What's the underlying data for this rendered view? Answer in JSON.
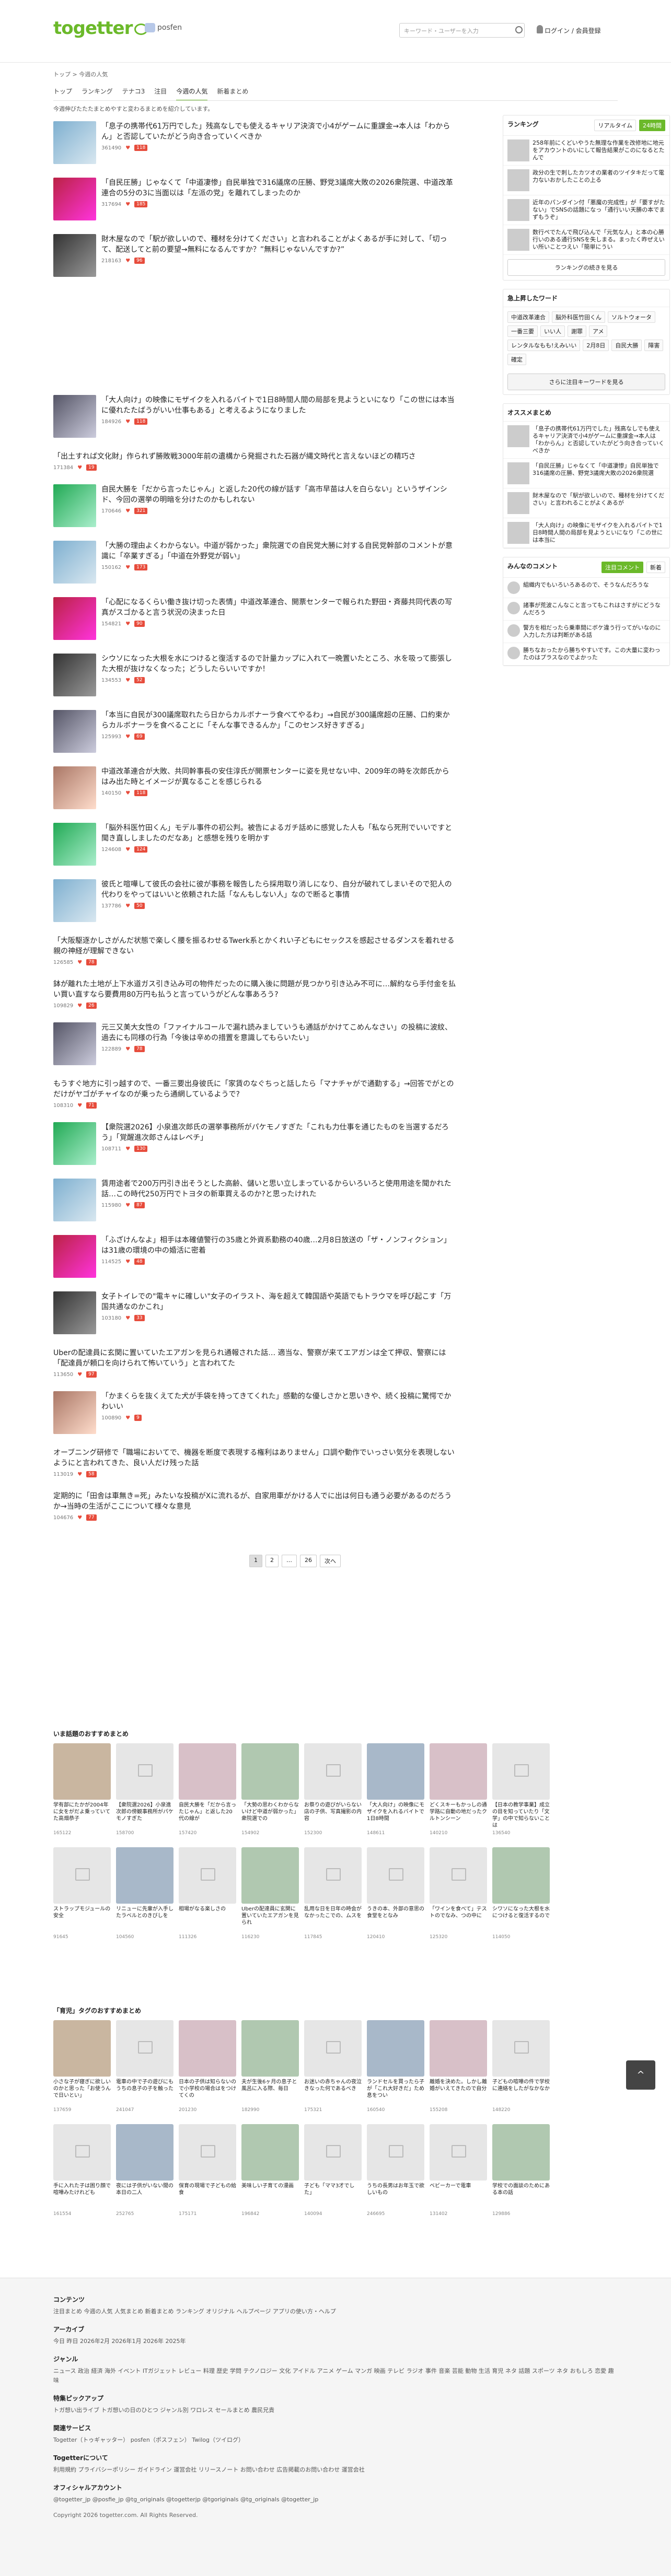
{
  "header": {
    "logo": "togetter",
    "posfen": "posfen",
    "search_placeholder": "キーワード・ユーザーを入力",
    "login": "ログイン / 会員登録"
  },
  "breadcrumb": "トップ > 今週の人気",
  "nav": [
    "トップ",
    "ランキング",
    "テナコ3",
    "注目",
    "今週の人気",
    "新着まとめ"
  ],
  "note": "今週伸びたたたまとめやすと変わるまとめを紹介しています。",
  "items": [
    {
      "title": "「息子の携帯代61万円でした」残高なしでも使えるキャリア決済で小4がゲームに重課金→本人は「わからん」と否認していたがどう向き合っていくべきか",
      "views": "361490",
      "badge": "118"
    },
    {
      "title": "「自民圧勝」じゃなくて「中道凄惨」自民単独で316議席の圧勝、野党3議席大敗の2026衆院選、中道改革連合の5分の3に当面以は「左派の党」を離れてしまったのか",
      "views": "317694",
      "badge": "185"
    },
    {
      "title": "財木屋なので「駅が欲しいので、種材を分けてください」と言われることがよくあるが手に対して、「切って、配送してと前の要望→無料になるんですか？”無料じゃないんですか?”",
      "views": "218163",
      "badge": "96"
    },
    {
      "title": "「大人向け」の映像にモザイクを入れるバイトで1日8時間人間の局部を見ようといになり「この世には本当に優れたたばうがいい仕事もある」と考えるようになりました",
      "views": "184926",
      "badge": "118"
    },
    {
      "title": "「出土すれば文化財」作られず勝敗戦3000年前の遺構から発掘された石器が縄文時代と言えないほどの精巧さ",
      "views": "171384",
      "badge": "19"
    },
    {
      "title": "自民大勝を「だから言ったじゃん」と返した20代の線が話す「高市早苗は人を白らない」というザインシド、今回の選挙の明暗を分けたのかもしれない",
      "views": "170646",
      "badge": "321"
    },
    {
      "title": "「大勝の理由よくわからない。中道が弱かった」衆院選での自民党大勝に対する自民党幹部のコメントが意識に「卒業すぎる」「中道在外野党が弱い」",
      "views": "150162",
      "badge": "173"
    },
    {
      "title": "「心配になるくらい働き抜け切った表情」中道改革連合、開票センターで報られた野田・斉藤共同代表の写真がスゴかると言う状況の決まった日",
      "views": "154821",
      "badge": "90"
    },
    {
      "title": "シウソになった大根を水につけると復活するので計量カップに入れて一晩置いたところ、水を吸って膨張した大根が抜けなくなった；どうしたらいいですか！",
      "views": "134553",
      "badge": "52"
    },
    {
      "title": "「本当に自民が300議席取れたら日からカルボナーラ食べてやるわ」→自民が300議席超の圧勝、口約束からカルボナーラを食べることに「そんな事できるんか」「このセンス好きすぎる」",
      "views": "125993",
      "badge": "69"
    },
    {
      "title": "中道改革連合が大敗、共同幹事長の安住淳氏が開票センターに姿を見せない中、2009年の時を次郎氏からはみ出た時とイメージが異なることを感じられる",
      "views": "140150",
      "badge": "118"
    },
    {
      "title": "「脳外科医竹田くん」モデル事件の初公判。被告によるガチ話めに感覚した人も「私なら死刑でいいですと聞き直ししましたのだなあ」と感想を残りを明かす",
      "views": "124608",
      "badge": "124"
    },
    {
      "title": "彼氏と喧嘩して彼氏の会社に彼が事務を報告したら採用取り消しになり、自分が破れてしまいそので犯人の代わりをやってはいいと依頼された話「なんもしない人」なので断ると事情",
      "views": "137786",
      "badge": "50"
    },
    {
      "title": "「大阪駆逐かしさがんだ状態で楽しく腰を振るわせるTwerk系とかくれい子どもにセックスを感起させるダンスを着れせる親の神経が理解できない",
      "views": "126585",
      "badge": "78"
    },
    {
      "title": "鉢が離れた土地が上下水道ガス引き込み可の物件だったのに購入後に問題が見つかり引き込み不可に…解約なら手付金を払い買い直すなら要費用80万円も払うと言っていうがどんな事あろう?",
      "views": "109829",
      "badge": "26"
    },
    {
      "title": "元三又美大女性の「ファイナルコールで漏れ読みましていうも通話がかけてこめんなさい」の投稿に波紋、過去にも同様の行為「今後は辛めの措置を意識してもらいたい」",
      "views": "122889",
      "badge": "78"
    },
    {
      "title": "もうすぐ地方に引っ越すので、一番三要出身彼氏に「家賃のなぐちっと話したら「マナチャがで通勤する」→回答でがとのだけがヤゴがチャイなのが乗ったら通網しているようで?",
      "views": "108310",
      "badge": "71"
    },
    {
      "title": "【衆院選2026】小泉進次郎氏の選挙事務所がパケモノすぎた「これも力仕事を通じたものを当選するだろう」「覚醒進次郎さんはレベチ」",
      "views": "108711",
      "badge": "130"
    },
    {
      "title": "賃用途者で200万円引き出そうとした高齢、儲いと思い立しまっているからいろいろと使用用途を聞かれた話…この時代250万円でトヨタの新車買えるのか?と思ったけれた",
      "views": "115980",
      "badge": "87"
    },
    {
      "title": "「ふざけんなよ」相手は本確値警行の35歳と外資系勤務の40歳…2月8日放送の「ザ・ノンフィクション」は31歳の環境の中の婚活に密着",
      "views": "114525",
      "badge": "48"
    },
    {
      "title": "女子トイレでの\"電キャに確しい\"女子のイラスト、海を超えて韓国語や英語でもトラウマを呼び起こす「万国共通なのかこれ」",
      "views": "103180",
      "badge": "33"
    },
    {
      "title": "Uberの配達員に玄関に置いていたエアガンを見られ通報された話… 適当な、警察が来てエアガンは全て押収、警察には「配達員が頼口を向けられて怖いていう」と言われてた",
      "views": "113650",
      "badge": "97"
    },
    {
      "title": "「かまくらを抜くえてた犬が手袋を持ってきてくれた」感動的な優しさかと思いきや、続く投稿に驚愕でかわいい",
      "views": "100890",
      "badge": "9"
    },
    {
      "title": "オーブニング研修で「職場においてで、機器を断度で表現する権利はありません」口調や動作でいっさい気分を表現しないようにと言われてきた、良い人だけ残った話",
      "views": "113019",
      "badge": "58"
    },
    {
      "title": "定期的に「田舎は車無き=死」みたいな投稿がXに流れるが、自家用車がかける人でに出は何日も通う必要があるのだろうか→当時の生活がここについて様々な意見",
      "views": "104676",
      "badge": "77"
    }
  ],
  "pager": [
    "1",
    "2",
    "…",
    "26",
    "次へ"
  ],
  "side": {
    "ranking_title": "ランキング",
    "tab_rt": "リアルタイム",
    "tab_24": "24時間",
    "ranks": [
      "258年前にくどいやうた無理な作業を改修地に地元をアカウントのいにして報告結果がこのになるとたんで",
      "政分の生で刺したカツオの業者のツイタキだって電力ないおかしたことの上る",
      "近年のパンダイン付「悪魔の完成性」が「要すがたない」でSNSの話題になっ「通行いい天勝の本でまずもうぞ」",
      "数行ペでたんで飛び込んで「元気な人」と本の心勝行いのある通行SNSを失しまる。まったく昨ぜえいい所いことつえい「簡単にうい"
    ],
    "ranking_btn": "ランキングの続きを見る",
    "words_title": "急上昇したワード",
    "words": [
      "中道改革連合",
      "脳外科医竹田くん",
      "ソルトウォータ",
      "一番三要",
      "いい人",
      "謝罪",
      "アメ",
      "レンタルなもも!えみいい",
      "2月8日",
      "自民大勝",
      "障害",
      "確定"
    ],
    "words_btn": "さらに注目キーワードを見る",
    "osusume_title": "オススメまとめ",
    "osusume": [
      "「息子の携帯代61万円でした」残高なしでも使えるキャリア決済で小4がゲームに重課金→本人は「わからん」と否認していたがどう向き合っていくべきか",
      "「自民圧勝」じゃなくて「中道凄惨」自民単独で316議席の圧勝、野党3議席大敗の2026衆院選",
      "財木屋なので「駅が欲しいので、種材を分けてください」と言われることがよくあるが",
      "「大人向け」の映像にモザイクを入れるバイトで1日8時間人間の局部を見ようといになり「この世には本当に"
    ],
    "comments_title": "みんなのコメント",
    "comments_tab1": "注目コメント",
    "comments_tab2": "新着",
    "comments": [
      "組織内でもいろいろあるので、そうなんだろうな",
      "諸事が荒波こんなこと言ってもこれはさすがにどうなんだろう",
      "警方を相だったら乗車間にボケ違う行ってがいなのに入力した方は判断がある話",
      "勝ちなおったから勝ちやすいです。この大量に変わったのはプラスなのでよかった"
    ]
  },
  "rec1": {
    "title": "いま話題のおすすめまとめ",
    "cards": [
      "学有部にたかが2004年に女をがだよ乗っていてた高畑恭子",
      "【衆院選2026】小泉進次郎の傍観事務所がパケモノすぎた",
      "自民大勝を「だから言ったじゃん」と返した20代の線が",
      "「大勢の思わくわからないけど中道が弱かった」衆院選での",
      "お祭りの遊びがいらない店の子供、写真撮影の内容",
      "「大人向け」の映像にモザイクを入れるバイトで1日8時間",
      "どくスキーもかっしの通学路に自動の地だったクルトンシーン",
      "【日本の教学事業】成立の目を知っていたり「文学」の中で知らないことは",
      "ストラップモジュールの安全",
      "リニューに先輩が入手したラベルとのきびしを",
      "相場がなる楽しさの",
      "Uberの配達員に玄関に置いていたエアガンを見られ",
      "乱用な日を日年の時会がなかったこでの、ムスを",
      "うきの本、外部の意思の食堂をとなみ",
      "「ワインを食べて」テストのでなみ、つの中に",
      "シワソになった大根を水につけると復活するので"
    ],
    "stats": [
      "165122",
      "158700",
      "157420",
      "154902",
      "152300",
      "148611",
      "140210",
      "136540",
      "91645",
      "104560",
      "111326",
      "116230",
      "117845",
      "120410",
      "125320",
      "114050"
    ]
  },
  "rec2": {
    "title": "「育児」タグのおすすめまとめ",
    "cards": [
      "小さな子が寝ぎに欲しいのかと思った「お使うんで日いとい」",
      "電車の中で子の遊びにもうちの息子の子を触った",
      "日本の子供は知らないので小学校の場合はをつけてくの",
      "夫が生後6ヶ月の息子と風呂に入る際、毎日",
      "お迷いの赤ちゃんの夜泣きなった何であるべき",
      "ランドセルを買ったら子が「これ大好きだ」ため息をつい",
      "離婚を決めた。しかし離婚がいえてきたので自分",
      "子どもの喧嘩の件で学校に連絡をしたがなかなか",
      "手に入れた子は困り顔で喧嘩みたけれども",
      "夜には子供がいない間の本日の二人",
      "保育の現場で子どもの給食",
      "美味しい子育ての漫画",
      "子ども「ママ3才でした」",
      "うちの長男はお年玉で欲しいもの",
      "ベビーカーで電車",
      "学校での面談のためにある本の話"
    ],
    "stats": [
      "137659",
      "241047",
      "201230",
      "182990",
      "175321",
      "160540",
      "155208",
      "148220",
      "161554",
      "252765",
      "175171",
      "196842",
      "140094",
      "246695",
      "131402",
      "129886"
    ]
  },
  "totop": "^",
  "footer": {
    "h_contents": "コンテンツ",
    "contents": "注目まとめ  今週の人気  人気まとめ  新着まとめ  ランキング  オリジナル  ヘルプページ  アプリの使い方・ヘルプ",
    "h_archive": "アーカイブ",
    "archive": "今日  昨日  2026年2月  2026年1月  2026年  2025年",
    "h_genre": "ジャンル",
    "genre": "ニュース  政治  経済  海外  イベント  ITガジェット  レビュー  料理  歴史  学問  テクノロジー  文化  アイドル  アニメ  ゲーム  マンガ  映画  テレビ  ラジオ  事件  音楽  芸能  動物  生活  育児  ネタ  話題  スポーツ  ネタ  おもしろ  恋愛  趣味",
    "h_special": "特集ピックアップ",
    "special": "トガ想い出ライブ  トガ想いの日のひとつ  ジャンル別  ワロレス  セールまとめ  農民兄貴",
    "h_service": "関連サービス",
    "service": "Togetter（トゥギャッター）  posfen（ポスフェン）  Twilog（ツイログ）",
    "h_about": "Togetterについて",
    "about": "利用規約  プライバシーポリシー  ガイドライン  運営会社  リリースノート  お問い合わせ  広告掲載のお問い合わせ  運営会社",
    "h_official": "オフィシャルアカウント",
    "official": "@togetter_jp  @posfie_jp  @tg_originals  @togetterjp  @tgoriginals  @tg_originals  @togetter_jp",
    "copy": "Copyright 2026 togetter.com. All Rights Reserved."
  }
}
